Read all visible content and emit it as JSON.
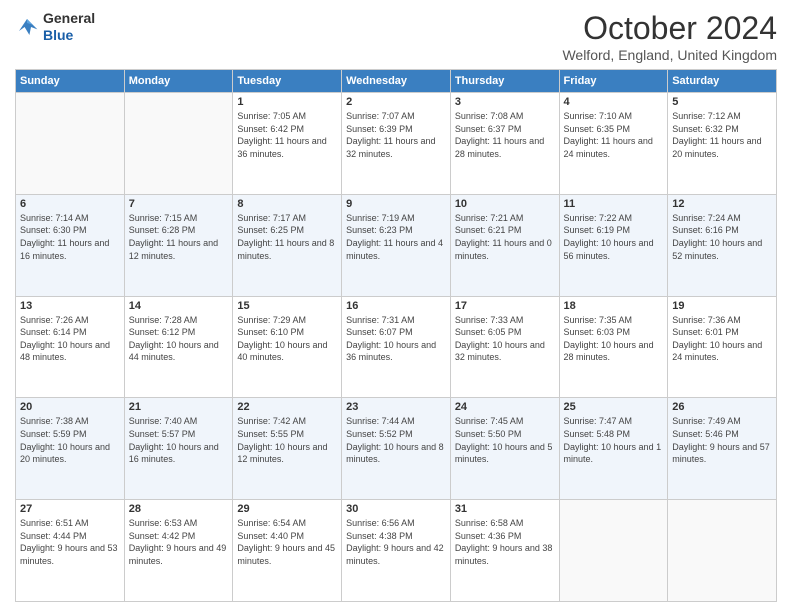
{
  "header": {
    "logo_line1": "General",
    "logo_line2": "Blue",
    "month_title": "October 2024",
    "location": "Welford, England, United Kingdom"
  },
  "days_of_week": [
    "Sunday",
    "Monday",
    "Tuesday",
    "Wednesday",
    "Thursday",
    "Friday",
    "Saturday"
  ],
  "weeks": [
    [
      {
        "day": "",
        "sunrise": "",
        "sunset": "",
        "daylight": ""
      },
      {
        "day": "",
        "sunrise": "",
        "sunset": "",
        "daylight": ""
      },
      {
        "day": "1",
        "sunrise": "Sunrise: 7:05 AM",
        "sunset": "Sunset: 6:42 PM",
        "daylight": "Daylight: 11 hours and 36 minutes."
      },
      {
        "day": "2",
        "sunrise": "Sunrise: 7:07 AM",
        "sunset": "Sunset: 6:39 PM",
        "daylight": "Daylight: 11 hours and 32 minutes."
      },
      {
        "day": "3",
        "sunrise": "Sunrise: 7:08 AM",
        "sunset": "Sunset: 6:37 PM",
        "daylight": "Daylight: 11 hours and 28 minutes."
      },
      {
        "day": "4",
        "sunrise": "Sunrise: 7:10 AM",
        "sunset": "Sunset: 6:35 PM",
        "daylight": "Daylight: 11 hours and 24 minutes."
      },
      {
        "day": "5",
        "sunrise": "Sunrise: 7:12 AM",
        "sunset": "Sunset: 6:32 PM",
        "daylight": "Daylight: 11 hours and 20 minutes."
      }
    ],
    [
      {
        "day": "6",
        "sunrise": "Sunrise: 7:14 AM",
        "sunset": "Sunset: 6:30 PM",
        "daylight": "Daylight: 11 hours and 16 minutes."
      },
      {
        "day": "7",
        "sunrise": "Sunrise: 7:15 AM",
        "sunset": "Sunset: 6:28 PM",
        "daylight": "Daylight: 11 hours and 12 minutes."
      },
      {
        "day": "8",
        "sunrise": "Sunrise: 7:17 AM",
        "sunset": "Sunset: 6:25 PM",
        "daylight": "Daylight: 11 hours and 8 minutes."
      },
      {
        "day": "9",
        "sunrise": "Sunrise: 7:19 AM",
        "sunset": "Sunset: 6:23 PM",
        "daylight": "Daylight: 11 hours and 4 minutes."
      },
      {
        "day": "10",
        "sunrise": "Sunrise: 7:21 AM",
        "sunset": "Sunset: 6:21 PM",
        "daylight": "Daylight: 11 hours and 0 minutes."
      },
      {
        "day": "11",
        "sunrise": "Sunrise: 7:22 AM",
        "sunset": "Sunset: 6:19 PM",
        "daylight": "Daylight: 10 hours and 56 minutes."
      },
      {
        "day": "12",
        "sunrise": "Sunrise: 7:24 AM",
        "sunset": "Sunset: 6:16 PM",
        "daylight": "Daylight: 10 hours and 52 minutes."
      }
    ],
    [
      {
        "day": "13",
        "sunrise": "Sunrise: 7:26 AM",
        "sunset": "Sunset: 6:14 PM",
        "daylight": "Daylight: 10 hours and 48 minutes."
      },
      {
        "day": "14",
        "sunrise": "Sunrise: 7:28 AM",
        "sunset": "Sunset: 6:12 PM",
        "daylight": "Daylight: 10 hours and 44 minutes."
      },
      {
        "day": "15",
        "sunrise": "Sunrise: 7:29 AM",
        "sunset": "Sunset: 6:10 PM",
        "daylight": "Daylight: 10 hours and 40 minutes."
      },
      {
        "day": "16",
        "sunrise": "Sunrise: 7:31 AM",
        "sunset": "Sunset: 6:07 PM",
        "daylight": "Daylight: 10 hours and 36 minutes."
      },
      {
        "day": "17",
        "sunrise": "Sunrise: 7:33 AM",
        "sunset": "Sunset: 6:05 PM",
        "daylight": "Daylight: 10 hours and 32 minutes."
      },
      {
        "day": "18",
        "sunrise": "Sunrise: 7:35 AM",
        "sunset": "Sunset: 6:03 PM",
        "daylight": "Daylight: 10 hours and 28 minutes."
      },
      {
        "day": "19",
        "sunrise": "Sunrise: 7:36 AM",
        "sunset": "Sunset: 6:01 PM",
        "daylight": "Daylight: 10 hours and 24 minutes."
      }
    ],
    [
      {
        "day": "20",
        "sunrise": "Sunrise: 7:38 AM",
        "sunset": "Sunset: 5:59 PM",
        "daylight": "Daylight: 10 hours and 20 minutes."
      },
      {
        "day": "21",
        "sunrise": "Sunrise: 7:40 AM",
        "sunset": "Sunset: 5:57 PM",
        "daylight": "Daylight: 10 hours and 16 minutes."
      },
      {
        "day": "22",
        "sunrise": "Sunrise: 7:42 AM",
        "sunset": "Sunset: 5:55 PM",
        "daylight": "Daylight: 10 hours and 12 minutes."
      },
      {
        "day": "23",
        "sunrise": "Sunrise: 7:44 AM",
        "sunset": "Sunset: 5:52 PM",
        "daylight": "Daylight: 10 hours and 8 minutes."
      },
      {
        "day": "24",
        "sunrise": "Sunrise: 7:45 AM",
        "sunset": "Sunset: 5:50 PM",
        "daylight": "Daylight: 10 hours and 5 minutes."
      },
      {
        "day": "25",
        "sunrise": "Sunrise: 7:47 AM",
        "sunset": "Sunset: 5:48 PM",
        "daylight": "Daylight: 10 hours and 1 minute."
      },
      {
        "day": "26",
        "sunrise": "Sunrise: 7:49 AM",
        "sunset": "Sunset: 5:46 PM",
        "daylight": "Daylight: 9 hours and 57 minutes."
      }
    ],
    [
      {
        "day": "27",
        "sunrise": "Sunrise: 6:51 AM",
        "sunset": "Sunset: 4:44 PM",
        "daylight": "Daylight: 9 hours and 53 minutes."
      },
      {
        "day": "28",
        "sunrise": "Sunrise: 6:53 AM",
        "sunset": "Sunset: 4:42 PM",
        "daylight": "Daylight: 9 hours and 49 minutes."
      },
      {
        "day": "29",
        "sunrise": "Sunrise: 6:54 AM",
        "sunset": "Sunset: 4:40 PM",
        "daylight": "Daylight: 9 hours and 45 minutes."
      },
      {
        "day": "30",
        "sunrise": "Sunrise: 6:56 AM",
        "sunset": "Sunset: 4:38 PM",
        "daylight": "Daylight: 9 hours and 42 minutes."
      },
      {
        "day": "31",
        "sunrise": "Sunrise: 6:58 AM",
        "sunset": "Sunset: 4:36 PM",
        "daylight": "Daylight: 9 hours and 38 minutes."
      },
      {
        "day": "",
        "sunrise": "",
        "sunset": "",
        "daylight": ""
      },
      {
        "day": "",
        "sunrise": "",
        "sunset": "",
        "daylight": ""
      }
    ]
  ]
}
